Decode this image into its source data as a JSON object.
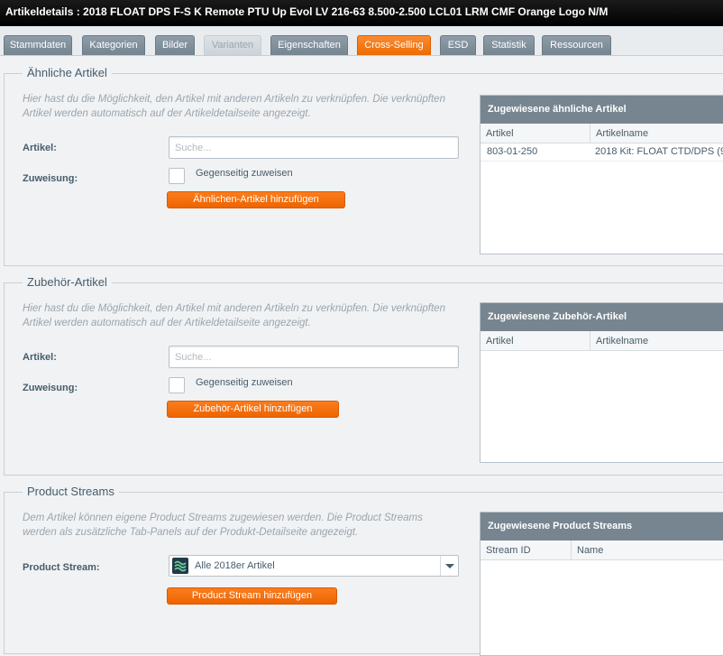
{
  "window": {
    "title": "Artikeldetails : 2018 FLOAT DPS F-S K Remote PTU Up Evol LV 216-63 8.500-2.500 LCL01 LRM CMF Orange Logo N/M"
  },
  "tabs": [
    {
      "label": "Stammdaten",
      "state": "normal"
    },
    {
      "label": "Kategorien",
      "state": "normal"
    },
    {
      "label": "Bilder",
      "state": "normal"
    },
    {
      "label": "Varianten",
      "state": "disabled"
    },
    {
      "label": "Eigenschaften",
      "state": "normal"
    },
    {
      "label": "Cross-Selling",
      "state": "active"
    },
    {
      "label": "ESD",
      "state": "normal"
    },
    {
      "label": "Statistik",
      "state": "normal"
    },
    {
      "label": "Ressourcen",
      "state": "normal"
    }
  ],
  "similar": {
    "legend": "Ähnliche Artikel",
    "description": "Hier hast du die Möglichkeit, den Artikel mit anderen Artikeln zu verknüpfen. Die verknüpften Artikel werden automatisch auf der Artikeldetailseite angezeigt.",
    "article_label": "Artikel:",
    "search_placeholder": "Suche...",
    "assignment_label": "Zuweisung:",
    "mutual_label": "Gegenseitig zuweisen",
    "add_button": "Ähnlichen-Artikel hinzufügen",
    "grid": {
      "title": "Zugewiesene ähnliche Artikel",
      "columns": [
        "Artikel",
        "Artikelname"
      ],
      "rows": [
        {
          "article": "803-01-250",
          "name": "2018 Kit: FLOAT CTD/DPS (9m"
        }
      ]
    }
  },
  "accessory": {
    "legend": "Zubehör-Artikel",
    "description": "Hier hast du die Möglichkeit, den Artikel mit anderen Artikeln zu verknüpfen. Die verknüpften Artikel werden automatisch auf der Artikeldetailseite angezeigt.",
    "article_label": "Artikel:",
    "search_placeholder": "Suche...",
    "assignment_label": "Zuweisung:",
    "mutual_label": "Gegenseitig zuweisen",
    "add_button": "Zubehör-Artikel hinzufügen",
    "grid": {
      "title": "Zugewiesene Zubehör-Artikel",
      "columns": [
        "Artikel",
        "Artikelname"
      ]
    }
  },
  "streams": {
    "legend": "Product Streams",
    "description": "Dem Artikel können eigene Product Streams zugewiesen werden. Die Product Streams werden als zusätzliche Tab-Panels auf der Produkt-Detailseite angezeigt.",
    "stream_label": "Product Stream:",
    "selected_stream": "Alle 2018er Artikel",
    "stream_icon": "stream-logo-icon",
    "add_button": "Product Stream hinzufügen",
    "grid": {
      "title": "Zugewiesene Product Streams",
      "columns": [
        "Stream ID",
        "Name"
      ]
    }
  },
  "colors": {
    "accent": "#f07005",
    "header": "#76858f",
    "titlebar": "#000000"
  }
}
